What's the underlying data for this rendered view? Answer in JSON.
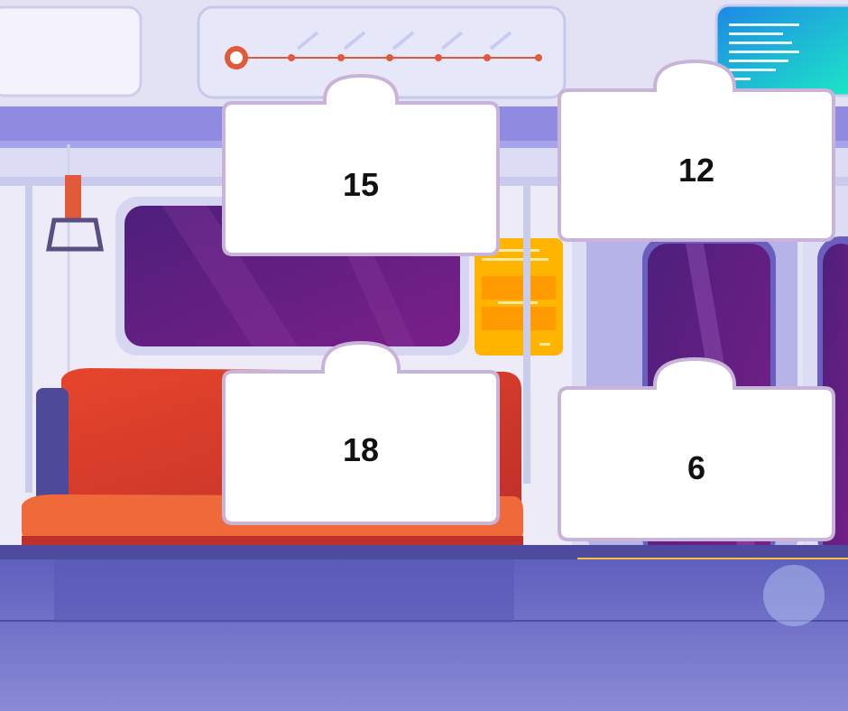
{
  "cards": [
    {
      "value": "15"
    },
    {
      "value": "12"
    },
    {
      "value": "18"
    },
    {
      "value": "6"
    }
  ],
  "colors": {
    "seat": "#E8502F",
    "window_glass": "#6A1E86",
    "route_accent": "#E05A3A",
    "info_panel": "#FFB400",
    "card_border": "#C8B4D8",
    "floor": "#6E6EC8"
  }
}
